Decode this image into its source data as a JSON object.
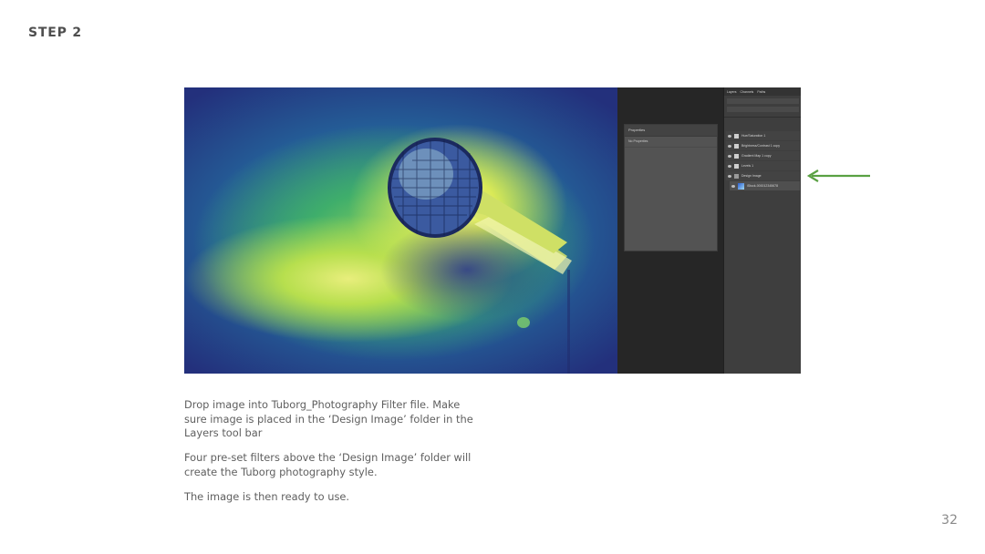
{
  "slide": {
    "title": "STEP 2",
    "page_number": "32"
  },
  "screenshot": {
    "properties_panel": {
      "title": "Properties",
      "subtitle": "No Properties"
    },
    "layers_panel": {
      "tabs": [
        "Layers",
        "Channels",
        "Paths"
      ],
      "layers": [
        {
          "name": "Hue/Saturation 1"
        },
        {
          "name": "Brightness/Contrast 1 copy"
        },
        {
          "name": "Gradient Map 1 copy"
        },
        {
          "name": "Levels 1"
        },
        {
          "name": "Design Image"
        },
        {
          "name": "iStock-000012345678"
        }
      ]
    },
    "accent_color": "#5aa143"
  },
  "captions": {
    "p1": "Drop image into Tuborg_Photography Filter file. Make sure image is placed in  the ‘Design Image’ folder in the Layers tool bar",
    "p2": "Four pre-set filters above the ‘Design Image’ folder will create the Tuborg photography style.",
    "p3": "The image is then ready to use."
  }
}
